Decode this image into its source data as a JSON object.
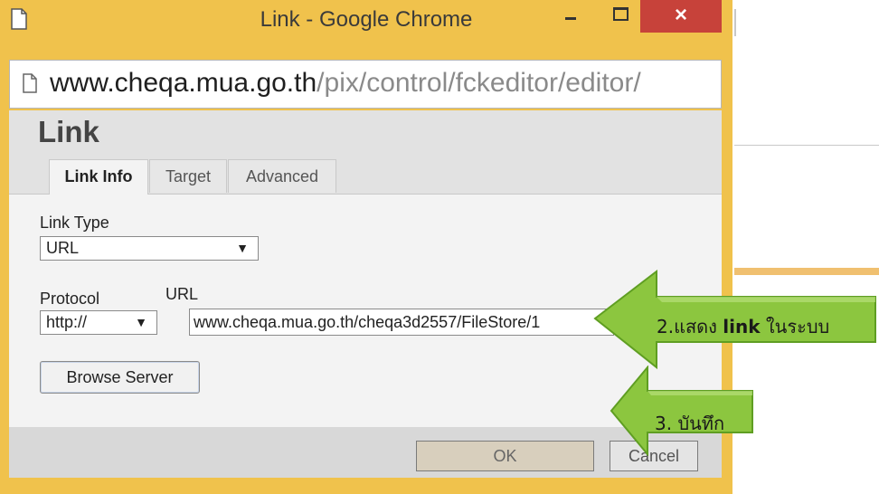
{
  "window": {
    "title": "Link - Google Chrome",
    "close_symbol": "×",
    "minimize_icon": "minimize-icon",
    "maximize_icon": "maximize-icon",
    "close_icon": "close-icon",
    "frame_color": "#f0c24c",
    "close_color": "#c7423a"
  },
  "address_bar": {
    "host": "www.cheqa.mua.go.th",
    "path": "/pix/control/fckeditor/editor/",
    "icon": "page-icon"
  },
  "dialog": {
    "title": "Link",
    "tabs": [
      {
        "label": "Link Info",
        "active": true
      },
      {
        "label": "Target",
        "active": false
      },
      {
        "label": "Advanced",
        "active": false
      }
    ],
    "link_type_label": "Link Type",
    "link_type_value": "URL",
    "protocol_label": "Protocol",
    "protocol_value": "http://",
    "url_label": "URL",
    "url_value": "www.cheqa.mua.go.th/cheqa3d2557/FileStore/1",
    "browse_button": "Browse Server",
    "ok_button": "OK",
    "cancel_button": "Cancel",
    "dropdown_arrow": "▼"
  },
  "callouts": [
    {
      "prefix": "2.แสดง ",
      "bold": "link",
      "suffix": " ในระบบ"
    },
    {
      "text": "3. บันทึก"
    }
  ],
  "colors": {
    "callout_green": "#8cc63f",
    "callout_green_dark": "#5f9e22"
  }
}
